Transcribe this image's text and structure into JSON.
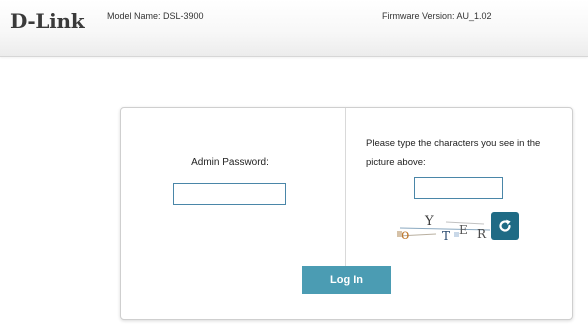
{
  "header": {
    "logo_text": "D-Link",
    "model_name": "Model Name: DSL-3900",
    "firmware_version": "Firmware Version: AU_1.02"
  },
  "login": {
    "password_label": "Admin Password:",
    "password_value": "",
    "captcha_prompt": "Please type the characters you see in the picture above:",
    "captcha_value": "",
    "captcha_text": "oYTERC",
    "refresh_icon": "refresh-icon",
    "login_label": "Log In"
  },
  "colors": {
    "accent": "#4b9cb3",
    "refresh_bg": "#1f6b85",
    "input_border": "#4a86a8"
  }
}
